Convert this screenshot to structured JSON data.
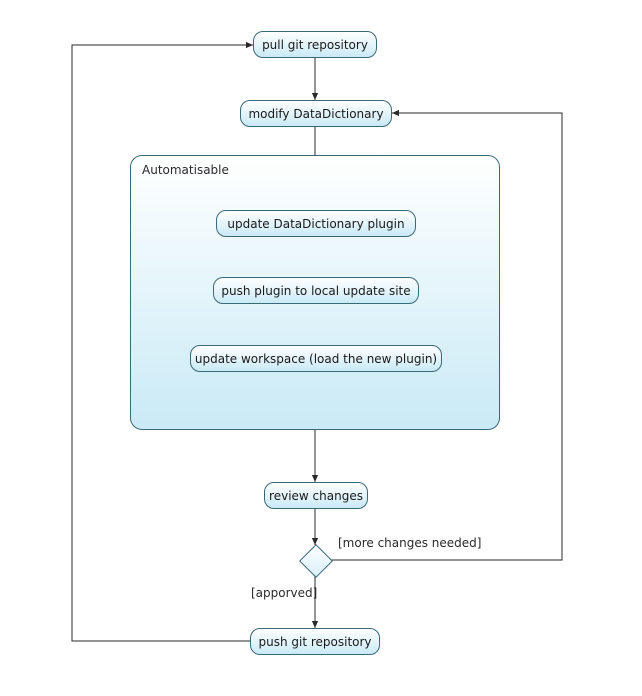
{
  "chart_data": {
    "type": "activity-diagram",
    "nodes": [
      {
        "id": "pull",
        "label": "pull git repository"
      },
      {
        "id": "modify",
        "label": "modify DataDictionary"
      },
      {
        "id": "updPlg",
        "label": "update DataDictionary plugin"
      },
      {
        "id": "pushLoc",
        "label": "push plugin to local update site"
      },
      {
        "id": "updWs",
        "label": "update workspace (load the new plugin)"
      },
      {
        "id": "review",
        "label": "review changes"
      },
      {
        "id": "push",
        "label": "push git repository"
      }
    ],
    "container": {
      "id": "auto",
      "label": "Automatisable",
      "contains": [
        "updPlg",
        "pushLoc",
        "updWs"
      ]
    },
    "decision": {
      "id": "dec",
      "branches": [
        {
          "target": "modify",
          "label": "[more changes needed]"
        },
        {
          "target": "push",
          "label": "[apporved]"
        }
      ]
    },
    "edges": [
      [
        "pull",
        "modify"
      ],
      [
        "modify",
        "updPlg"
      ],
      [
        "updPlg",
        "pushLoc"
      ],
      [
        "pushLoc",
        "updWs"
      ],
      [
        "updWs",
        "review"
      ],
      [
        "review",
        "dec"
      ],
      [
        "dec",
        "push"
      ],
      [
        "dec",
        "modify"
      ],
      [
        "push",
        "pull"
      ]
    ]
  },
  "nodes": {
    "pull": {
      "label": "pull git repository"
    },
    "modify": {
      "label": "modify DataDictionary"
    },
    "updPlg": {
      "label": "update DataDictionary plugin"
    },
    "pushLoc": {
      "label": "push plugin to local update site"
    },
    "updWs": {
      "label": "update workspace (load the new plugin)"
    },
    "review": {
      "label": "review changes"
    },
    "push": {
      "label": "push git repository"
    }
  },
  "container": {
    "label": "Automatisable"
  },
  "decision_labels": {
    "more": "[more changes needed]",
    "approved": "[apporved]"
  }
}
